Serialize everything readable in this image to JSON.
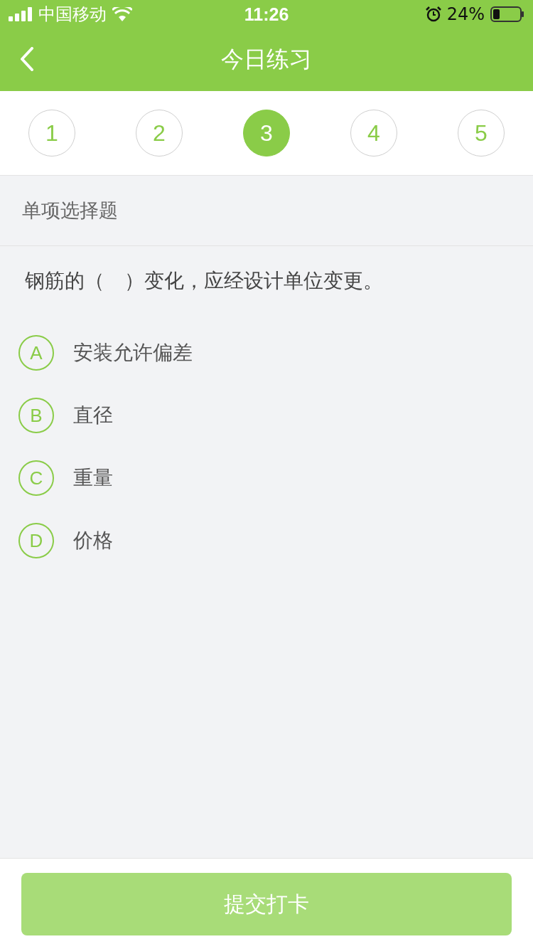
{
  "status_bar": {
    "carrier": "中国移动",
    "time": "11:26",
    "battery": "24%"
  },
  "nav": {
    "title": "今日练习"
  },
  "steps": [
    {
      "label": "1",
      "selected": false
    },
    {
      "label": "2",
      "selected": false
    },
    {
      "label": "3",
      "selected": true
    },
    {
      "label": "4",
      "selected": false
    },
    {
      "label": "5",
      "selected": false
    }
  ],
  "section": {
    "title": "单项选择题"
  },
  "question": {
    "text": "钢筋的（　）变化，应经设计单位变更。",
    "options": [
      {
        "letter": "A",
        "text": "安装允许偏差",
        "selected": false
      },
      {
        "letter": "B",
        "text": "直径",
        "selected": false
      },
      {
        "letter": "C",
        "text": "重量",
        "selected": false
      },
      {
        "letter": "D",
        "text": "价格",
        "selected": false
      }
    ]
  },
  "submit": {
    "label": "提交打卡",
    "disabled": true
  }
}
